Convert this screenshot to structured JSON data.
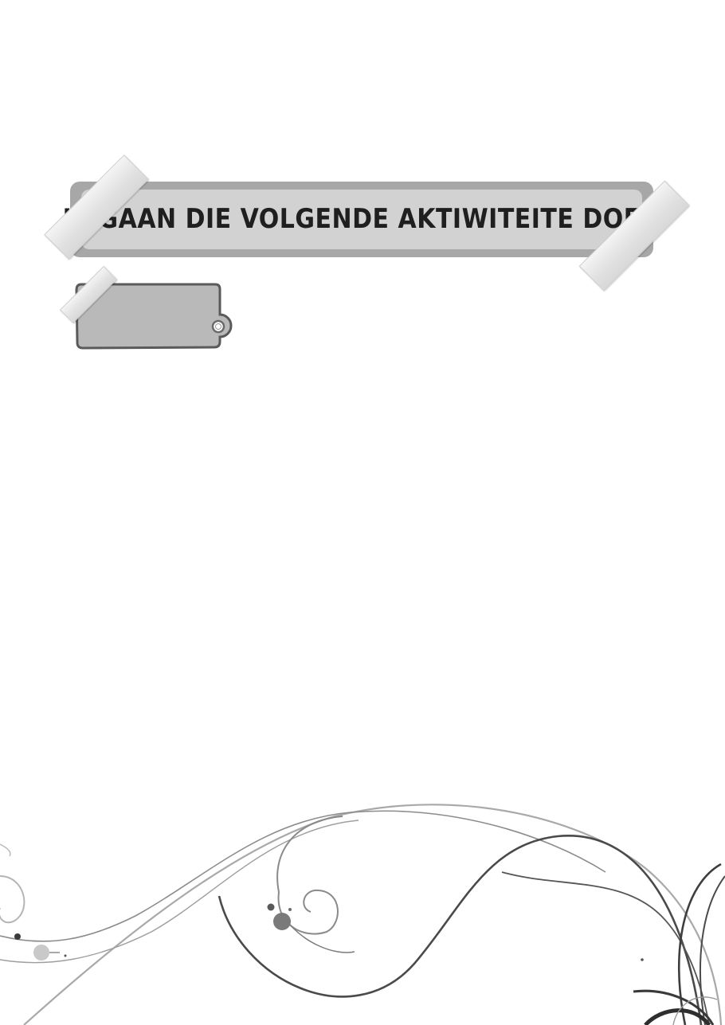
{
  "banner": {
    "title": "JY GAAN DIE VOLGENDE AKTIWITEITE DOEN"
  },
  "colors": {
    "banner_outer": "#a7a7a7",
    "banner_inner": "#d2d2d2",
    "title_text": "#1f1f1f",
    "tag_fill": "#b9b9b9",
    "tag_border": "#5a5a5a",
    "swirl_dark": "#4a4a4a",
    "swirl_light": "#a9a9a9"
  },
  "icons": {
    "tag": "blank-label-tag-icon",
    "tape": "sticky-tape-icon",
    "decoration": "floral-swirl-decoration"
  }
}
